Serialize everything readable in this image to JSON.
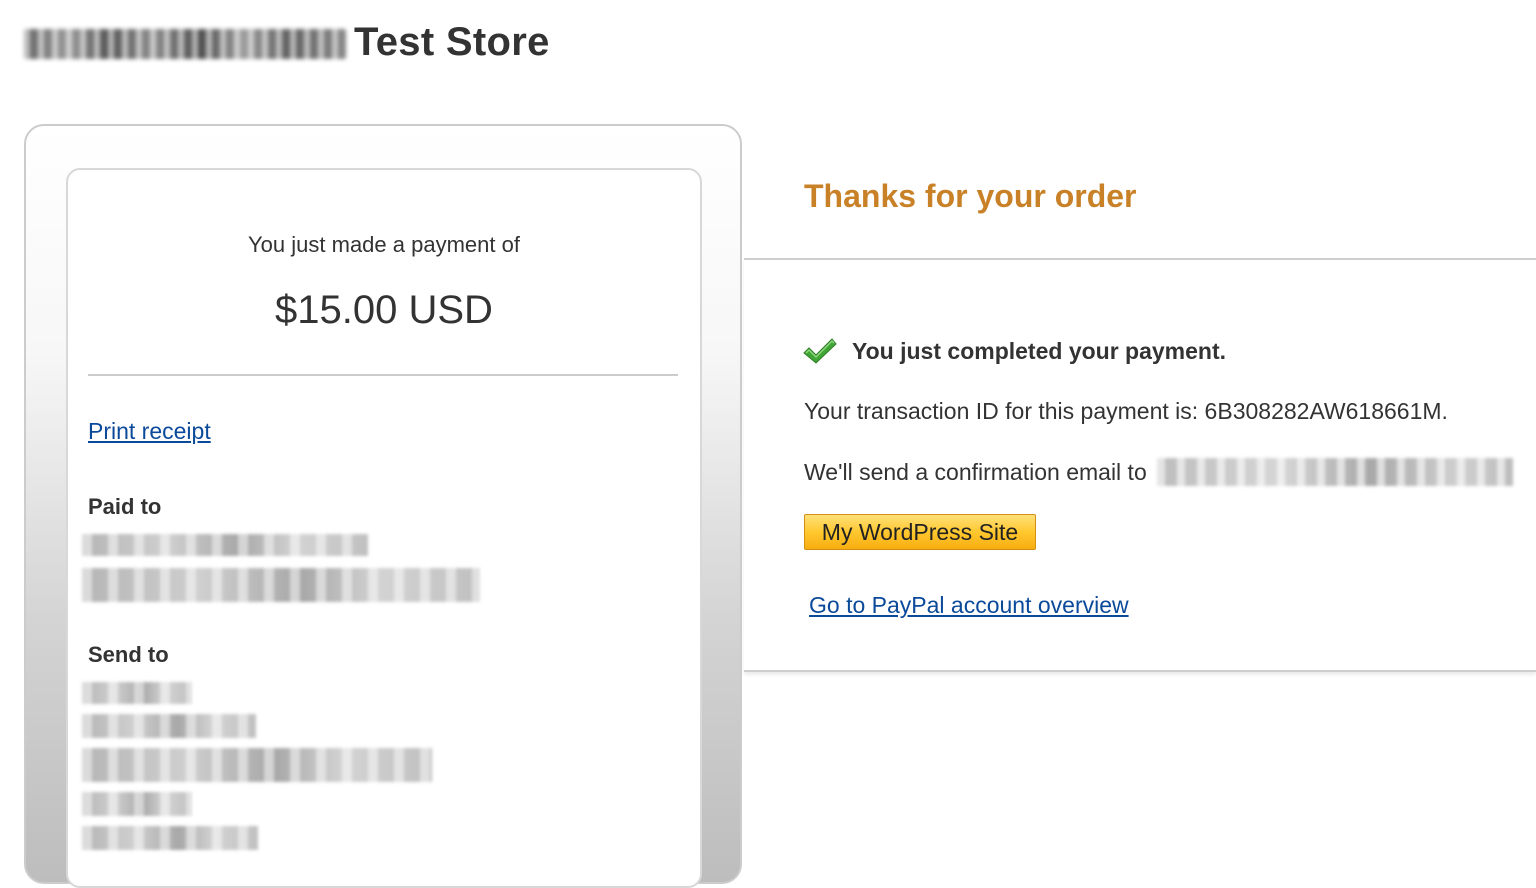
{
  "store": {
    "title": "Test Store"
  },
  "receipt": {
    "payment_caption": "You just made a payment of",
    "amount": "$15.00 USD",
    "print_receipt_label": "Print receipt",
    "paid_to_label": "Paid to",
    "send_to_label": "Send to"
  },
  "confirmation": {
    "heading": "Thanks for your order",
    "completed_message": "You just completed your payment.",
    "transaction_line": "Your transaction ID for this payment is: 6B308282AW618661M.",
    "email_line_prefix": "We'll send a confirmation email to",
    "return_button_label": "My WordPress Site",
    "account_overview_link": "Go to PayPal account overview"
  },
  "colors": {
    "heading_accent": "#c98127",
    "link": "#0b4a9a",
    "button_gold": "#ffc82f",
    "check_green": "#3fa535"
  },
  "icons": {
    "completed": "check-icon"
  }
}
